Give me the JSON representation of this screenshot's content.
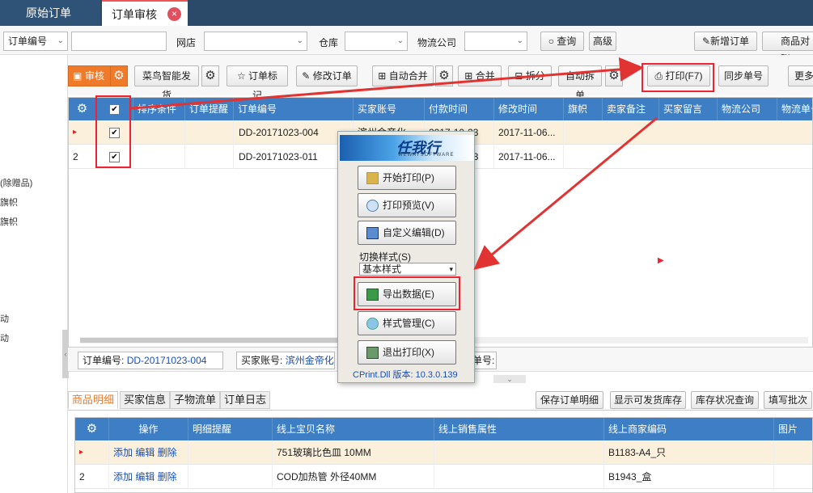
{
  "tabs": [
    {
      "label": "原始订单"
    },
    {
      "label": "订单审核",
      "close": "×"
    }
  ],
  "search": {
    "field_select": "订单编号",
    "shop_label": "网店",
    "warehouse_label": "仓库",
    "logistics_label": "物流公司",
    "query_button": "查询",
    "advanced_button": "高级",
    "new_order_button": "新增订单",
    "goods_button": "商品对账"
  },
  "sidebar": {
    "items": [
      "(除赠品)",
      "旗帜",
      "旗帜",
      "动",
      "动"
    ],
    "collapse": "‹"
  },
  "toolbar": {
    "audit": "审核",
    "cainiao": "菜鸟智能发货",
    "mark": "订单标记",
    "modify": "修改订单",
    "auto_merge": "自动合并",
    "merge": "合并",
    "split": "拆分",
    "auto_split": "自动拆单",
    "print": "打印(F7)",
    "sync": "同步单号",
    "more": "更多"
  },
  "grid": {
    "headers": [
      "排序条件",
      "订单提醒",
      "订单编号",
      "买家账号",
      "付款时间",
      "修改时间",
      "旗帜",
      "卖家备注",
      "买家留言",
      "物流公司",
      "物流单号"
    ],
    "rows": [
      {
        "num": "▸",
        "order": "DD-20171023-004",
        "buyer": "滨州金帝化",
        "pay": "2017-10-23",
        "mod": "2017-11-06..."
      },
      {
        "num": "2",
        "order": "DD-20171023-011",
        "buyer": "",
        "pay": "2017-10-23",
        "mod": "2017-11-06..."
      }
    ]
  },
  "detail": {
    "order_label": "订单编号:",
    "order_value": "DD-20171023-004",
    "buyer_label": "买家账号:",
    "buyer_value": "滨州金帝化",
    "extra_label": "单号:"
  },
  "bottom_tabs": [
    "商品明细",
    "买家信息",
    "子物流单",
    "订单日志"
  ],
  "bottom_actions": [
    "保存订单明细",
    "显示可发货库存",
    "库存状况查询",
    "填写批次"
  ],
  "bottom_grid": {
    "headers": [
      "操作",
      "明细提醒",
      "线上宝贝名称",
      "线上销售属性",
      "线上商家编码",
      "图片"
    ],
    "rows": [
      {
        "num": "▸",
        "ops": "添加 编辑 删除",
        "name": "751玻璃比色皿  10MM",
        "code": "B1183-A4_只"
      },
      {
        "num": "2",
        "ops": "添加 编辑 删除",
        "name": "COD加热管 外径40MM",
        "code": "B1943_盒"
      }
    ]
  },
  "popup": {
    "logo": "任我行",
    "logo_sub": "WEWAYSOFTWARE",
    "buttons": [
      "开始打印(P)",
      "打印预览(V)",
      "自定义编辑(D)"
    ],
    "style_label": "切换样式(S)",
    "style_value": "基本样式",
    "export": "导出数据(E)",
    "style_manage": "样式管理(C)",
    "exit": "退出打印(X)",
    "version": "CPrint.Dll 版本: 10.3.0.139"
  },
  "colors": {
    "accent": "#ee7a2a",
    "header_blue": "#3d7ec4",
    "annotation_red": "#e23333"
  }
}
